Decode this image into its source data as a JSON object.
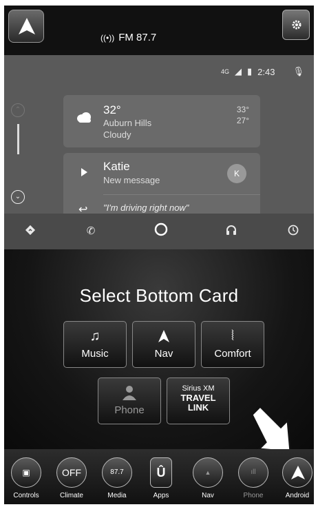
{
  "top_bar": {
    "radio_label": "FM 87.7",
    "radio_icon": "radio-broadcast-icon"
  },
  "android_auto": {
    "status": {
      "network": "4G",
      "time": "2:43"
    },
    "weather": {
      "temp": "32°",
      "location": "Auburn Hills",
      "condition": "Cloudy",
      "high": "33°",
      "low": "27°"
    },
    "message": {
      "sender": "Katie",
      "subtitle": "New message",
      "avatar_initial": "K",
      "reply": "\"I'm driving right now\""
    },
    "nav_icons": [
      "navigation-icon",
      "phone-icon",
      "home-circle-icon",
      "headphones-icon",
      "recents-icon"
    ]
  },
  "picker": {
    "title": "Select Bottom Card",
    "buttons": [
      {
        "label": "Music",
        "icon": "music-note-icon"
      },
      {
        "label": "Nav",
        "icon": "nav-arrow-icon"
      },
      {
        "label": "Comfort",
        "icon": "seat-heat-icon"
      },
      {
        "label": "Phone",
        "icon": "person-icon",
        "disabled": true
      },
      {
        "line1": "Sirius XM",
        "line2": "TRAVEL",
        "line3": "LINK"
      }
    ]
  },
  "dock": {
    "items": [
      {
        "label": "Controls",
        "icon": "controls-icon"
      },
      {
        "label": "Climate",
        "button_text": "OFF"
      },
      {
        "label": "Media",
        "button_text": "87.7"
      },
      {
        "label": "Apps",
        "icon": "uconnect-apps-icon"
      },
      {
        "label": "Nav",
        "icon": "nav-arrow-icon"
      },
      {
        "label": "Phone",
        "icon": "phone-signal-icon",
        "dim": true
      },
      {
        "label": "Android",
        "icon": "android-auto-icon"
      }
    ]
  }
}
